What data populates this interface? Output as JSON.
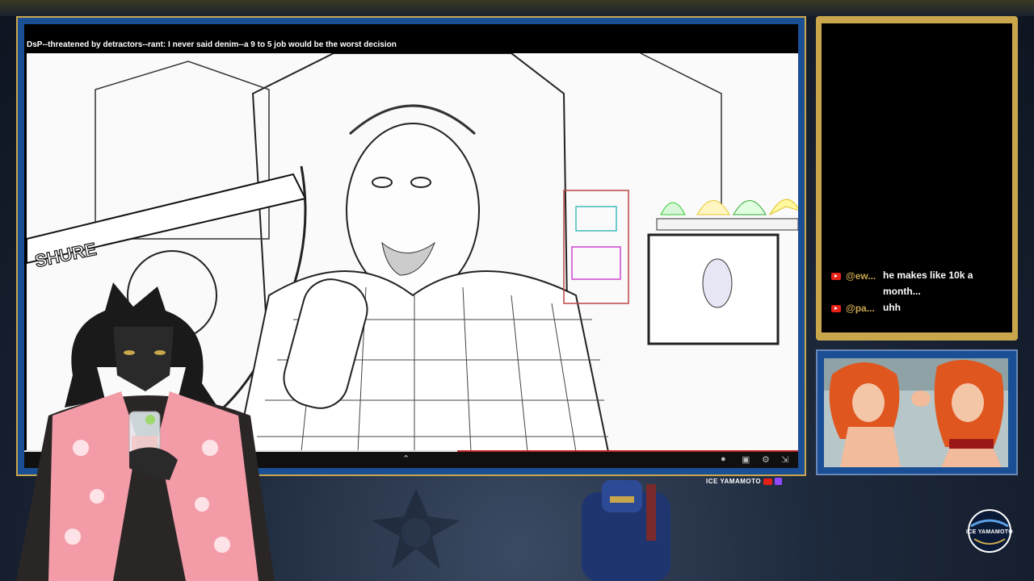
{
  "video": {
    "title": "DsP--threatened by detractors--rant: I never said denim--a 9 to 5 job would be the worst decision",
    "mic_brand": "SHURE",
    "progress": 0.56
  },
  "chat": {
    "messages": [
      {
        "user": "@ew...",
        "text": "he makes like 10k a month..."
      },
      {
        "user": "@pa...",
        "text": "uhh"
      }
    ]
  },
  "brand": {
    "name": "ICE YAMAMOTO",
    "logo_text": "ICE YAMAMOTO"
  },
  "colors": {
    "frame_gold": "#c9a64c",
    "frame_blue": "#1a4f96",
    "youtube_red": "#e62117",
    "twitch_purple": "#9146ff"
  },
  "icons": {
    "player": [
      "chevron-up-icon",
      "settings-icon",
      "captions-icon",
      "gear-icon",
      "exit-fullscreen-icon"
    ],
    "overlay": [
      "like-icon",
      "dislike-icon",
      "comment-icon",
      "share-icon"
    ]
  }
}
